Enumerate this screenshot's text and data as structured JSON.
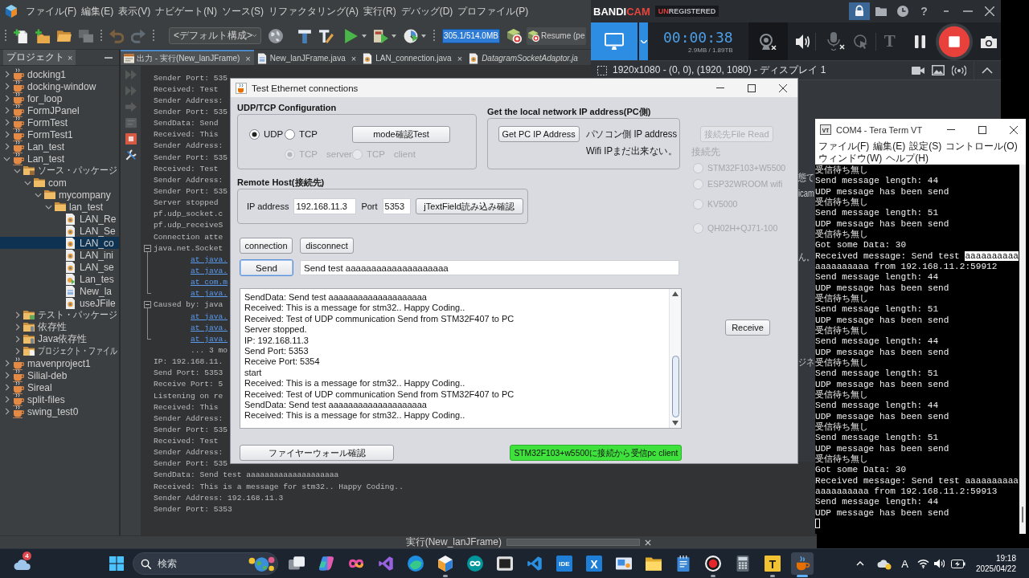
{
  "ide": {
    "menu": [
      "ファイル(F)",
      "編集(E)",
      "表示(V)",
      "ナビゲート(N)",
      "ソース(S)",
      "リファクタリング(A)",
      "実行(R)",
      "デバッグ(D)",
      "プロファイル(P)"
    ],
    "toolbar": [
      {
        "kind": "new-file",
        "disabled": false
      },
      {
        "kind": "new-project",
        "disabled": false
      },
      {
        "kind": "open-project",
        "disabled": false
      },
      {
        "kind": "close-project",
        "disabled": true
      },
      {
        "kind": "undo",
        "disabled": true
      },
      {
        "kind": "redo",
        "disabled": true
      },
      {
        "kind": "config",
        "value": "<デフォルト構成>",
        "disabled": false
      },
      {
        "kind": "globe",
        "disabled": false
      },
      {
        "kind": "build",
        "disabled": false
      },
      {
        "kind": "clean-build",
        "disabled": false
      },
      {
        "kind": "run",
        "disabled": false
      },
      {
        "kind": "debug",
        "disabled": false
      },
      {
        "kind": "profile",
        "disabled": false
      },
      {
        "kind": "memory",
        "text": "305.1/514.0MB",
        "disabled": false
      },
      {
        "kind": "gc",
        "disabled": false
      },
      {
        "kind": "resume",
        "text": "Resume (pe",
        "disabled": false
      }
    ],
    "project_panel": {
      "tab": "プロジェクト",
      "close": "×",
      "selected": true,
      "tree": [
        {
          "label": "docking1",
          "kind": "project",
          "expanded": false,
          "selected": false
        },
        {
          "label": "docking-window",
          "kind": "project",
          "expanded": false,
          "selected": false
        },
        {
          "label": "for_loop",
          "kind": "project",
          "expanded": false,
          "selected": false
        },
        {
          "label": "FormJPanel",
          "kind": "project",
          "expanded": false,
          "selected": false
        },
        {
          "label": "FormTest",
          "kind": "project",
          "expanded": false,
          "selected": false
        },
        {
          "label": "FormTest1",
          "kind": "project",
          "expanded": false,
          "selected": false
        },
        {
          "label": "Lan_test",
          "kind": "project",
          "expanded": false,
          "selected": false
        },
        {
          "label": "Lan_test",
          "kind": "project",
          "expanded": true,
          "selected": false,
          "children": [
            {
              "label": "ソース・パッケージ",
              "kind": "source-folder",
              "expanded": true,
              "selected": false,
              "children": [
                {
                  "label": "com",
                  "kind": "package",
                  "expanded": true,
                  "selected": false,
                  "children": [
                    {
                      "label": "mycompany",
                      "kind": "package",
                      "expanded": true,
                      "selected": false,
                      "children": [
                        {
                          "label": "lan_test",
                          "kind": "package",
                          "expanded": true,
                          "selected": false,
                          "children": [
                            {
                              "label": "LAN_Re",
                              "kind": "class",
                              "selected": false
                            },
                            {
                              "label": "LAN_Se",
                              "kind": "class",
                              "selected": false
                            },
                            {
                              "label": "LAN_co",
                              "kind": "class",
                              "selected": true
                            },
                            {
                              "label": "LAN_ini",
                              "kind": "class",
                              "selected": false
                            },
                            {
                              "label": "LAN_se",
                              "kind": "class",
                              "selected": false
                            },
                            {
                              "label": "Lan_tes",
                              "kind": "main-class",
                              "selected": false
                            },
                            {
                              "label": "New_la",
                              "kind": "form",
                              "selected": false
                            },
                            {
                              "label": "useJFile",
                              "kind": "class",
                              "selected": false
                            }
                          ]
                        }
                      ]
                    }
                  ]
                }
              ]
            },
            {
              "label": "テスト・パッケージ",
              "kind": "test-folder",
              "expanded": false,
              "selected": false
            },
            {
              "label": "依存性",
              "kind": "deps-folder",
              "expanded": false,
              "selected": false
            },
            {
              "label": "Java依存性",
              "kind": "deps-folder",
              "expanded": false,
              "selected": false
            },
            {
              "label": "プロジェクト・ファイル",
              "kind": "files-folder",
              "expanded": false,
              "selected": false
            }
          ]
        },
        {
          "label": "mavenproject1",
          "kind": "project",
          "expanded": false,
          "selected": false
        },
        {
          "label": "Silial-deb",
          "kind": "project",
          "expanded": false,
          "selected": false
        },
        {
          "label": "Sireal",
          "kind": "project",
          "expanded": false,
          "selected": false
        },
        {
          "label": "split-files",
          "kind": "project",
          "expanded": false,
          "selected": false
        },
        {
          "label": "swing_test0",
          "kind": "project",
          "expanded": false,
          "selected": false
        }
      ]
    },
    "editor_tabs": [
      {
        "label": "出力 - 実行(New_lanJFrame)",
        "kind": "output",
        "selected": true,
        "library": false,
        "close": "×"
      },
      {
        "label": "New_lanJFrame.java",
        "kind": "form",
        "selected": false,
        "library": false,
        "close": "×"
      },
      {
        "label": "LAN_connection.java",
        "kind": "class",
        "selected": false,
        "library": false,
        "close": "×"
      },
      {
        "label": "DatagramSocketAdaptor.ja",
        "kind": "class",
        "selected": false,
        "library": true
      }
    ],
    "output": {
      "buttons": [
        {
          "kind": "rerun",
          "disabled": true
        },
        {
          "kind": "rerun-options",
          "disabled": true
        },
        {
          "kind": "continue",
          "disabled": true
        },
        {
          "kind": "threads",
          "disabled": true
        },
        {
          "kind": "stop",
          "disabled": false
        },
        {
          "kind": "settings",
          "disabled": false
        }
      ],
      "lines": [
        {
          "text": "Sender Port: 535",
          "kind": "text"
        },
        {
          "text": "Received: Test",
          "kind": "text"
        },
        {
          "text": "Sender Address:",
          "kind": "text"
        },
        {
          "text": "Sender Port: 535",
          "kind": "text"
        },
        {
          "text": "SendData: Send",
          "kind": "text"
        },
        {
          "text": "Received: This",
          "kind": "text"
        },
        {
          "text": "Sender Address:",
          "kind": "text"
        },
        {
          "text": "Sender Port: 535",
          "kind": "text"
        },
        {
          "text": "Received: Test",
          "kind": "text"
        },
        {
          "text": "Sender Address:",
          "kind": "text"
        },
        {
          "text": "Sender Port: 535",
          "kind": "text"
        },
        {
          "text": "Server stopped",
          "kind": "text"
        },
        {
          "text": "pf.udp_socket.c",
          "kind": "text"
        },
        {
          "text": "pf.udp_receiveS",
          "kind": "text"
        },
        {
          "text": "Connection atte",
          "kind": "text"
        },
        {
          "text": "java.net.Socket",
          "kind": "text",
          "expanded": true,
          "children": [
            {
              "text": "at java.",
              "kind": "link"
            },
            {
              "text": "at java.",
              "kind": "link"
            },
            {
              "text": "at com.m",
              "kind": "link"
            },
            {
              "text": "at java.",
              "kind": "link"
            }
          ]
        },
        {
          "text": "Caused by: java",
          "kind": "text",
          "expanded": true,
          "children": [
            {
              "text": "at java.",
              "kind": "link"
            },
            {
              "text": "at java.",
              "kind": "link"
            },
            {
              "text": "at java.",
              "kind": "link"
            }
          ]
        },
        {
          "text": "... 3 mo",
          "kind": "indent"
        },
        {
          "text": "IP: 192.168.11.",
          "kind": "text"
        },
        {
          "text": "Send Port: 5353",
          "kind": "text"
        },
        {
          "text": "Receive Port: 5",
          "kind": "text"
        },
        {
          "text": "Listening on re",
          "kind": "text"
        },
        {
          "text": "Received: This",
          "kind": "text"
        },
        {
          "text": "Sender Address:",
          "kind": "text"
        },
        {
          "text": "Sender Port: 535",
          "kind": "text"
        },
        {
          "text": "Received: Test",
          "kind": "text"
        },
        {
          "text": "Sender Address:",
          "kind": "text"
        },
        {
          "text": "Sender Port: 535",
          "kind": "text"
        },
        {
          "text": "SendData: Send test aaaaaaaaaaaaaaaaaaaa",
          "kind": "text"
        },
        {
          "text": "Received: This is a message for stm32.. Happy Coding..",
          "kind": "text"
        },
        {
          "text": "Sender Address: 192.168.11.3",
          "kind": "text"
        },
        {
          "text": "Sender Port: 5353",
          "kind": "text"
        }
      ]
    },
    "status": {
      "task": "実行(New_lanJFrame)"
    }
  },
  "bandicam": {
    "logo": [
      {
        "text": "BANDI",
        "color": "#ffffff"
      },
      {
        "text": "CAM",
        "color": "#e8463d"
      }
    ],
    "badge": [
      {
        "text": "UN",
        "color": "#e03c3c"
      },
      {
        "text": "REGISTERED",
        "color": "#b8bcc0"
      }
    ],
    "pinned": true,
    "help": "?",
    "screen_mode_selected": true,
    "timer": "00:00:38",
    "size": "2.9MB / 1.89TB",
    "webcam_on": false,
    "mic_on": false,
    "text_tool": "T",
    "region": "1920x1080 - (0, 0), (1920, 1080) - ディスプレイ 1",
    "fragments": [
      "態て",
      "icam",
      "ん。",
      "ジネ"
    ]
  },
  "dialog": {
    "title": "Test Ethernet connections",
    "udp_tcp": {
      "heading": "UDP/TCP Configuration",
      "protocols": [
        {
          "label": "UDP",
          "selected": true
        },
        {
          "label": "TCP",
          "selected": false
        }
      ],
      "mode_button": "mode確認Test",
      "roles": [
        {
          "label": "TCP",
          "caption": "server",
          "selected": true,
          "disabled": true
        },
        {
          "label": "TCP",
          "caption": "client",
          "selected": false,
          "disabled": true
        }
      ]
    },
    "local_ip": {
      "heading": "Get the local network IP address(PC側)",
      "button": "Get PC IP Address",
      "info": [
        "パソコン側 IP address",
        "Wifi IPまだ出来ない。"
      ]
    },
    "remote_host": {
      "heading": "Remote Host(接続先)",
      "ip_label": "IP address",
      "ip_value": "192.168.11.3",
      "port_label": "Port",
      "port_value": "5353",
      "check_button": "jTextField読み込み確認"
    },
    "connect_buttons": [
      "connection",
      "disconnect"
    ],
    "send": {
      "button": "Send",
      "focused": true,
      "value": "Send test aaaaaaaaaaaaaaaaaaaa"
    },
    "log": [
      "SendData: Send test aaaaaaaaaaaaaaaaaaaa",
      "Received: This is a message for stm32.. Happy Coding..",
      "Received: Test of UDP communication Send from STM32F407 to PC",
      "Server stopped.",
      "IP: 192.168.11.3",
      "Send Port: 5353",
      "Receive Port: 5354",
      "start",
      "Received: This is a message for stm32.. Happy Coding..",
      "Received: Test of UDP communication Send from STM32F407 to PC",
      "SendData: Send test aaaaaaaaaaaaaaaaaaaa",
      "Received: This is a message for stm32.. Happy Coding.."
    ],
    "firewall_button": "ファイヤーウォール確認",
    "client_button": "STM32F103+w5500に接続から受信pc client",
    "targets": {
      "button": "接続先File Read",
      "disabled": true,
      "heading": "接続先",
      "options": [
        {
          "label": "STM32F103+W5500",
          "selected": false,
          "disabled": true
        },
        {
          "label": "ESP32WROOM wifi",
          "selected": false,
          "disabled": true
        },
        {
          "label": "KV5000",
          "selected": false,
          "disabled": true
        },
        {
          "label": "QH02H+QJ71-100",
          "selected": false,
          "disabled": true
        }
      ]
    },
    "receive_button": "Receive"
  },
  "teraterm": {
    "icon_text": "VT",
    "title": "COM4 - Tera Term VT",
    "menu": [
      "ファイル(F)",
      "編集(E)",
      "設定(S)",
      "コントロール(O)",
      "ウィンドウ(W)",
      "ヘルプ(H)"
    ],
    "lines": [
      {
        "text": "受信待ち無し"
      },
      {
        "text": "Send message length: 44"
      },
      {
        "text": "UDP message has been send"
      },
      {
        "text": "受信待ち無し"
      },
      {
        "text": "Send message length: 51"
      },
      {
        "text": "UDP message has been send"
      },
      {
        "text": "受信待ち無し"
      },
      {
        "text": "Got some Data: 30"
      },
      {
        "text": "Received message: Send test ",
        "selected_text": "aaaaaaaaaa"
      },
      {
        "text": "aaaaaaaaaa from 192.168.11.2:59912"
      },
      {
        "text": "Send message length: 44"
      },
      {
        "text": "UDP message has been send"
      },
      {
        "text": "受信待ち無し"
      },
      {
        "text": "Send message length: 51"
      },
      {
        "text": "UDP message has been send"
      },
      {
        "text": "受信待ち無し"
      },
      {
        "text": "Send message length: 44"
      },
      {
        "text": "UDP message has been send"
      },
      {
        "text": "受信待ち無し"
      },
      {
        "text": "Send message length: 51"
      },
      {
        "text": "UDP message has been send"
      },
      {
        "text": "受信待ち無し"
      },
      {
        "text": "Send message length: 44"
      },
      {
        "text": "UDP message has been send"
      },
      {
        "text": "受信待ち無し"
      },
      {
        "text": "Send message length: 51"
      },
      {
        "text": "UDP message has been send"
      },
      {
        "text": "受信待ち無し"
      },
      {
        "text": "Got some Data: 30"
      },
      {
        "text": "Received message: Send test aaaaaaaaaa"
      },
      {
        "text": "aaaaaaaaaa from 192.168.11.2:59913"
      },
      {
        "text": "Send message length: 44"
      },
      {
        "text": "UDP message has been send"
      }
    ],
    "cursor": true
  },
  "taskbar": {
    "widget_badge": "4",
    "search_placeholder": "検索",
    "apps": [
      {
        "kind": "task-view",
        "running": false,
        "active": false
      },
      {
        "kind": "swirl",
        "running": false,
        "active": false
      },
      {
        "kind": "loop",
        "running": false,
        "active": false
      },
      {
        "kind": "ribbon-violet",
        "running": false,
        "active": false
      },
      {
        "kind": "wave",
        "running": false,
        "active": false
      },
      {
        "kind": "cube",
        "running": true,
        "active": false
      },
      {
        "kind": "infinity-circle",
        "running": false,
        "active": false
      },
      {
        "kind": "chip",
        "running": false,
        "active": false
      },
      {
        "kind": "ribbon-blue",
        "running": false,
        "active": false
      },
      {
        "kind": "text-tile",
        "label": "IDE",
        "running": false,
        "active": false
      },
      {
        "kind": "text-tile",
        "label": "X",
        "running": false,
        "active": false
      },
      {
        "kind": "picture",
        "running": false,
        "active": false
      },
      {
        "kind": "folder",
        "running": false,
        "active": false
      },
      {
        "kind": "notepad",
        "running": false,
        "active": false
      },
      {
        "kind": "record",
        "running": true,
        "active": false
      },
      {
        "kind": "calculator",
        "running": false,
        "active": false
      },
      {
        "kind": "t-tile",
        "label": "T",
        "running": true,
        "active": false
      },
      {
        "kind": "coffee",
        "running": true,
        "active": true
      }
    ],
    "ime": "A",
    "time": "19:18",
    "date": "2025/04/22"
  }
}
